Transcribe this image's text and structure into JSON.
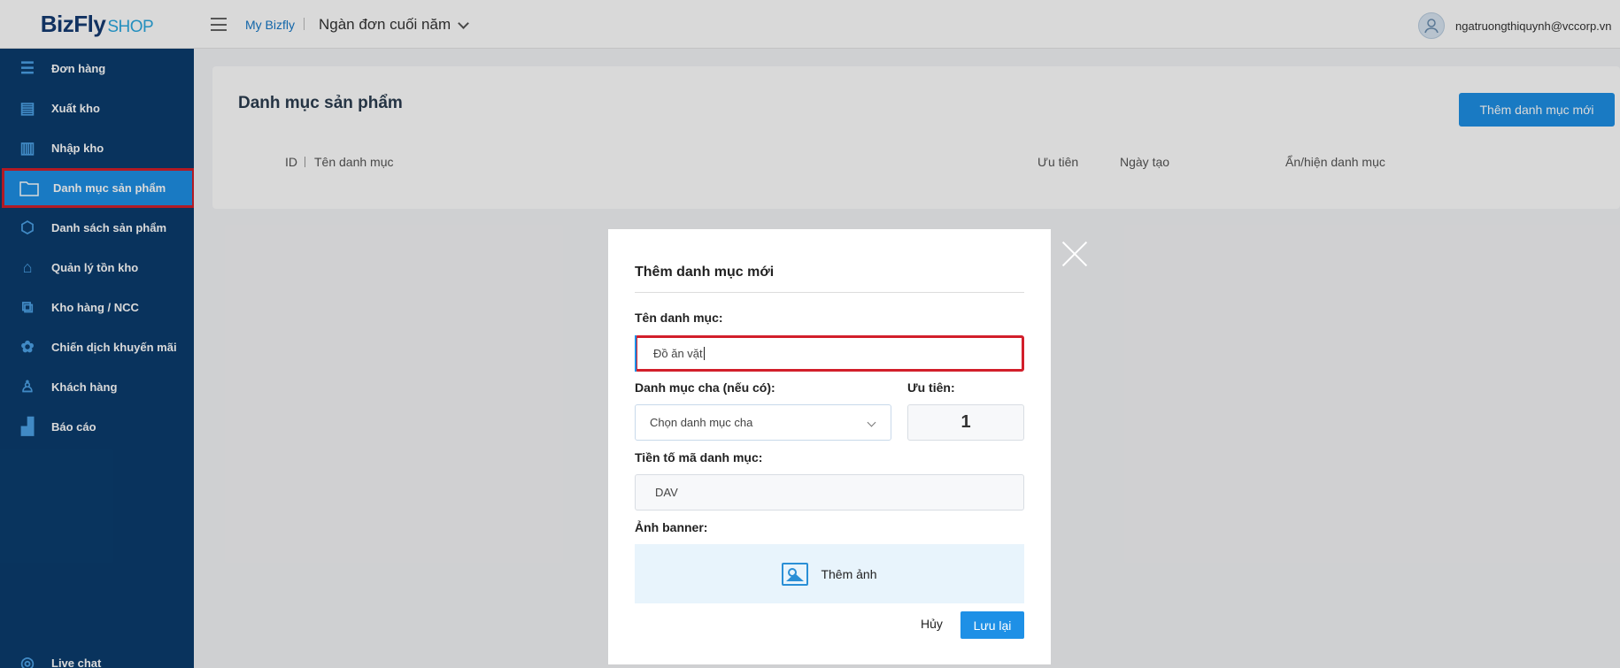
{
  "topbar": {
    "logo_main": "BizFly",
    "logo_sub": "SHOP",
    "my_bizfly": "My Bizfly",
    "shop_name": "Ngàn đơn cuối năm",
    "user_email": "ngatruongthiquynh@vccorp.vn"
  },
  "sidebar": {
    "items": [
      {
        "label": "Đơn hàng",
        "icon": "order-icon"
      },
      {
        "label": "Xuất kho",
        "icon": "export-warehouse-icon"
      },
      {
        "label": "Nhập kho",
        "icon": "import-warehouse-icon"
      },
      {
        "label": "Danh mục sản phẩm",
        "icon": "folder-icon"
      },
      {
        "label": "Danh sách sản phẩm",
        "icon": "boxes-icon"
      },
      {
        "label": "Quản lý tồn kho",
        "icon": "inventory-icon"
      },
      {
        "label": "Kho hàng / NCC",
        "icon": "supplier-icon"
      },
      {
        "label": "Chiến dịch khuyến mãi",
        "icon": "promotion-icon"
      },
      {
        "label": "Khách hàng",
        "icon": "customers-icon"
      },
      {
        "label": "Báo cáo",
        "icon": "report-icon"
      }
    ],
    "live_chat": "Live chat",
    "active_index": 3
  },
  "page": {
    "title": "Danh mục sản phẩm",
    "add_button": "Thêm danh mục mới",
    "columns": [
      "ID",
      "Tên danh mục",
      "Ưu tiên",
      "Ngày tạo",
      "Ẩn/hiện danh mục"
    ]
  },
  "modal": {
    "title": "Thêm danh mục mới",
    "name_label": "Tên danh mục:",
    "name_value": "Đồ ăn vặt",
    "parent_label": "Danh mục cha (nếu có):",
    "parent_placeholder": "Chọn danh mục cha",
    "priority_label": "Ưu tiên:",
    "priority_value": "1",
    "prefix_label": "Tiền tố mã danh mục:",
    "prefix_value": "DAV",
    "banner_label": "Ảnh banner:",
    "banner_button": "Thêm ảnh",
    "cancel": "Hủy",
    "save": "Lưu lại"
  },
  "colors": {
    "sidebar_bg": "#0b3d6e",
    "primary": "#1e90e6",
    "highlight_border": "#d21f2b"
  }
}
